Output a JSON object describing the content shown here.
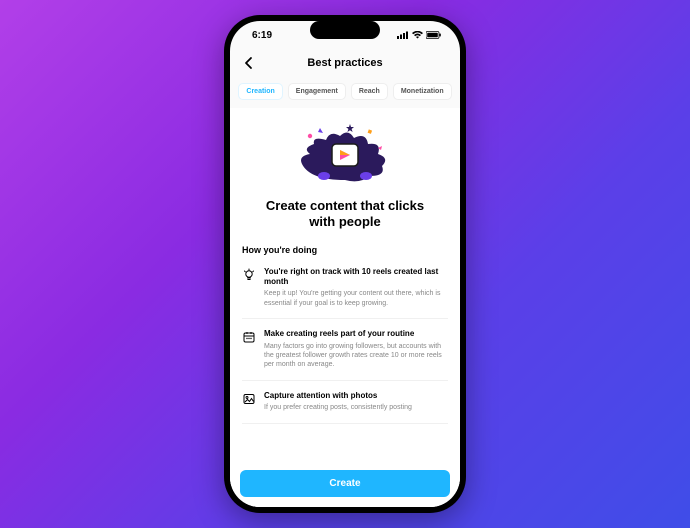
{
  "status": {
    "time": "6:19"
  },
  "header": {
    "title": "Best practices"
  },
  "tabs": [
    {
      "label": "Creation",
      "active": true
    },
    {
      "label": "Engagement",
      "active": false
    },
    {
      "label": "Reach",
      "active": false
    },
    {
      "label": "Monetization",
      "active": false
    }
  ],
  "hero": {
    "title": "Create content that clicks with people"
  },
  "section": {
    "title": "How you're doing"
  },
  "items": [
    {
      "icon": "lightbulb-icon",
      "title": "You're right on track with 10 reels created last month",
      "desc": "Keep it up! You're getting your content out there, which is essential if your goal is to keep growing."
    },
    {
      "icon": "calendar-icon",
      "title": "Make creating reels part of your routine",
      "desc": "Many factors go into growing followers, but accounts with the greatest follower growth rates create 10 or more reels per month on average."
    },
    {
      "icon": "photo-icon",
      "title": "Capture attention with photos",
      "desc": "If you prefer creating posts, consistently posting"
    }
  ],
  "cta": {
    "label": "Create"
  }
}
